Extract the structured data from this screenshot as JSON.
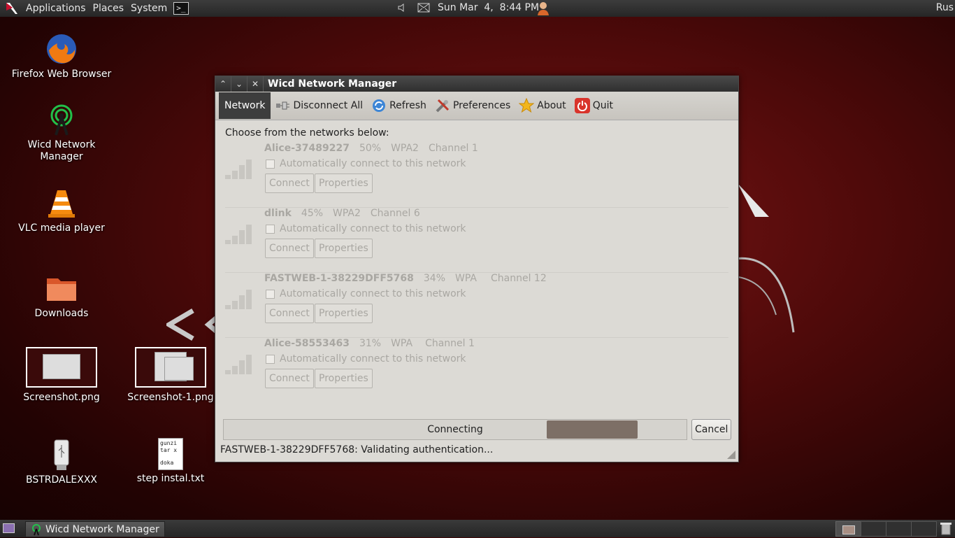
{
  "top_panel": {
    "menus": [
      "Applications",
      "Places",
      "System"
    ],
    "clock": "Sun Mar  4,  8:44 PM",
    "user": "Rus",
    "terminal_glyph": ">_"
  },
  "desktop": {
    "icons": [
      {
        "label": "Firefox Web Browser"
      },
      {
        "label": "Wicd Network\nManager"
      },
      {
        "label": "VLC media player"
      },
      {
        "label": "Downloads"
      },
      {
        "label": "Screenshot.png"
      },
      {
        "label": "Screenshot-1.png"
      },
      {
        "label": "BSTRDALEXXX"
      },
      {
        "label": "step instal.txt"
      }
    ],
    "txt_preview": [
      "gunzi",
      "tar x",
      "doka"
    ]
  },
  "window": {
    "title": "Wicd Network Manager",
    "toolbar": {
      "network": "Network",
      "disconnect_all": "Disconnect All",
      "refresh": "Refresh",
      "preferences": "Preferences",
      "about": "About",
      "quit": "Quit"
    },
    "choose_label": "Choose from the networks below:",
    "auto_label": "Automatically connect to this network",
    "connect_label": "Connect",
    "properties_label": "Properties",
    "networks": [
      {
        "ssid": "Alice-37489227",
        "strength": "50%",
        "encryption": "WPA2",
        "channel": "Channel 1"
      },
      {
        "ssid": "dlink",
        "strength": "45%",
        "encryption": "WPA2",
        "channel": "Channel 6"
      },
      {
        "ssid": "FASTWEB-1-38229DFF5768",
        "strength": "34%",
        "encryption": "WPA",
        "channel": "Channel 12"
      },
      {
        "ssid": "Alice-58553463",
        "strength": "31%",
        "encryption": "WPA",
        "channel": "Channel 1"
      }
    ],
    "progress": {
      "label": "Connecting"
    },
    "cancel_label": "Cancel",
    "status": "FASTWEB-1-38229DFF5768: Validating authentication..."
  },
  "taskbar": {
    "task_label": "Wicd Network Manager"
  },
  "colors": {
    "progress_fill": "#7d6f66",
    "panel": "#2e2e2e",
    "quit_red": "#d9342b"
  }
}
